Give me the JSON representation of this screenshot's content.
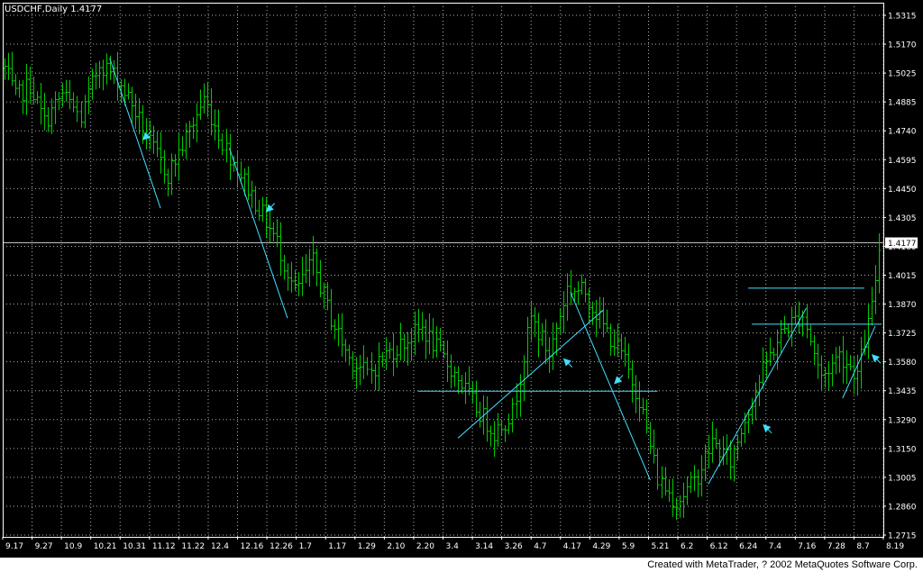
{
  "colors": {
    "background": "#000000",
    "frame": "#ffffff",
    "grid": "#ffffff",
    "bars": "#00cc00",
    "trendlines": "#40e0ff",
    "arrows": "#40e0ff",
    "price_line": "#c0c0c0",
    "axis_text": "#ffffff",
    "footer_bg": "#ffffff",
    "footer_text": "#000000"
  },
  "footer": {
    "text": "Created with MetaTrader, ? 2002 MetaQuotes Software Corp."
  },
  "chart_data": {
    "type": "bar",
    "title": "USDCHF,Daily  1.4177",
    "symbol": "USDCHF",
    "timeframe": "Daily",
    "current_price_label": "1.4177",
    "current_price": 1.4177,
    "grid": true,
    "ylim": [
      1.2715,
      1.5315
    ],
    "y_tick_labels": [
      "1.5315",
      "1.5170",
      "1.5025",
      "1.4885",
      "1.4740",
      "1.4595",
      "1.4450",
      "1.4305",
      "1.4160",
      "1.4015",
      "1.3870",
      "1.3725",
      "1.3580",
      "1.3435",
      "1.3290",
      "1.3150",
      "1.3005",
      "1.2860",
      "1.2715"
    ],
    "x_tick_labels": [
      "9.17",
      "9.27",
      "10.9",
      "10.21",
      "10.31",
      "11.12",
      "11.22",
      "12.4",
      "12.16",
      "12.26",
      "1.7",
      "1.17",
      "1.29",
      "2.10",
      "2.20",
      "3.4",
      "3.14",
      "3.26",
      "4.7",
      "4.17",
      "4.29",
      "5.9",
      "5.21",
      "6.2",
      "6.12",
      "6.24",
      "7.4",
      "7.16",
      "7.28",
      "8.7",
      "8.19"
    ],
    "x_range": [
      0,
      241
    ],
    "anchors": [
      [
        0,
        1.505
      ],
      [
        3,
        1.49
      ],
      [
        7,
        1.497
      ],
      [
        11,
        1.478
      ],
      [
        16,
        1.492
      ],
      [
        21,
        1.48
      ],
      [
        26,
        1.508
      ],
      [
        31,
        1.5
      ],
      [
        35,
        1.487
      ],
      [
        40,
        1.467
      ],
      [
        45,
        1.452
      ],
      [
        50,
        1.47
      ],
      [
        55,
        1.49
      ],
      [
        60,
        1.468
      ],
      [
        65,
        1.452
      ],
      [
        70,
        1.435
      ],
      [
        75,
        1.418
      ],
      [
        80,
        1.393
      ],
      [
        85,
        1.408
      ],
      [
        90,
        1.38
      ],
      [
        95,
        1.36
      ],
      [
        100,
        1.352
      ],
      [
        105,
        1.362
      ],
      [
        110,
        1.368
      ],
      [
        115,
        1.375
      ],
      [
        120,
        1.362
      ],
      [
        125,
        1.35
      ],
      [
        130,
        1.335
      ],
      [
        135,
        1.323
      ],
      [
        140,
        1.333
      ],
      [
        145,
        1.38
      ],
      [
        150,
        1.362
      ],
      [
        155,
        1.395
      ],
      [
        160,
        1.393
      ],
      [
        165,
        1.376
      ],
      [
        170,
        1.362
      ],
      [
        175,
        1.34
      ],
      [
        180,
        1.3
      ],
      [
        185,
        1.288
      ],
      [
        190,
        1.298
      ],
      [
        195,
        1.318
      ],
      [
        200,
        1.308
      ],
      [
        205,
        1.335
      ],
      [
        210,
        1.358
      ],
      [
        215,
        1.375
      ],
      [
        220,
        1.382
      ],
      [
        225,
        1.35
      ],
      [
        230,
        1.362
      ],
      [
        235,
        1.352
      ],
      [
        239,
        1.385
      ],
      [
        241,
        1.415
      ]
    ],
    "horizontal_lines": [
      {
        "price": 1.3435,
        "from": 114,
        "to": 180
      },
      {
        "price": 1.395,
        "from": 205,
        "to": 237
      },
      {
        "price": 1.377,
        "from": 206,
        "to": 243
      }
    ],
    "trendlines": [
      {
        "from": [
          29,
          1.51
        ],
        "to": [
          43,
          1.435
        ]
      },
      {
        "from": [
          62,
          1.465
        ],
        "to": [
          78,
          1.38
        ]
      },
      {
        "from": [
          125,
          1.32
        ],
        "to": [
          165,
          1.384
        ]
      },
      {
        "from": [
          156,
          1.393
        ],
        "to": [
          178,
          1.299
        ]
      },
      {
        "from": [
          194,
          1.297
        ],
        "to": [
          221,
          1.385
        ]
      },
      {
        "from": [
          231,
          1.34
        ],
        "to": [
          240,
          1.376
        ]
      }
    ],
    "arrows": [
      {
        "at": [
          38,
          1.469
        ],
        "direction": "down-left"
      },
      {
        "at": [
          72,
          1.433
        ],
        "direction": "down-left"
      },
      {
        "at": [
          154,
          1.36
        ],
        "direction": "up-left"
      },
      {
        "at": [
          168,
          1.347
        ],
        "direction": "down-left"
      },
      {
        "at": [
          209,
          1.327
        ],
        "direction": "up-left"
      },
      {
        "at": [
          239,
          1.362
        ],
        "direction": "up-left"
      }
    ]
  }
}
